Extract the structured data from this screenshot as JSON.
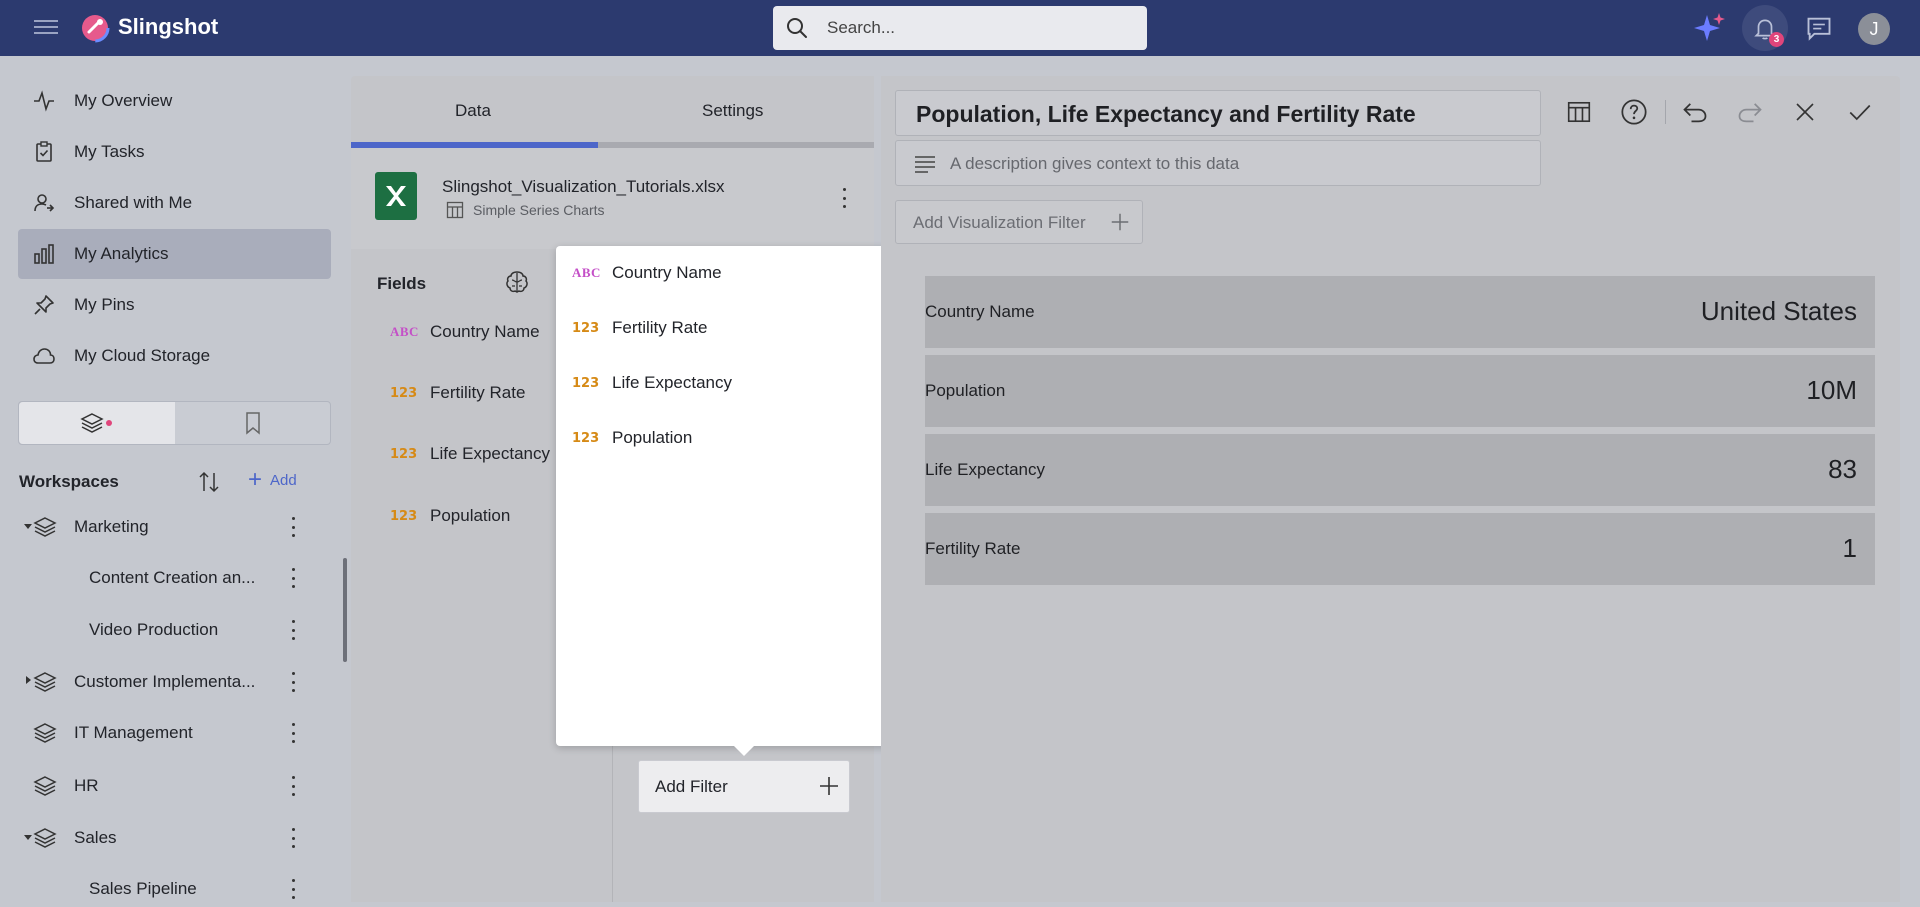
{
  "app": {
    "brand": "Slingshot"
  },
  "search": {
    "placeholder": "Search..."
  },
  "notifications": {
    "count": "3"
  },
  "user": {
    "initial": "J"
  },
  "sidebar": {
    "nav": [
      {
        "label": "My Overview",
        "icon": "activity-icon"
      },
      {
        "label": "My Tasks",
        "icon": "clipboard-check-icon"
      },
      {
        "label": "Shared with Me",
        "icon": "user-share-icon"
      },
      {
        "label": "My Analytics",
        "icon": "bar-chart-icon",
        "active": true
      },
      {
        "label": "My Pins",
        "icon": "pin-icon"
      },
      {
        "label": "My Cloud Storage",
        "icon": "cloud-icon"
      }
    ],
    "workspaces_title": "Workspaces",
    "add_label": "Add",
    "tree": [
      {
        "label": "Marketing",
        "level": 0,
        "expanded": true
      },
      {
        "label": "Content Creation an...",
        "level": 1
      },
      {
        "label": "Video Production",
        "level": 1
      },
      {
        "label": "Customer Implementa...",
        "level": 0,
        "expanded": false
      },
      {
        "label": "IT Management",
        "level": 0
      },
      {
        "label": "HR",
        "level": 0
      },
      {
        "label": "Sales",
        "level": 0,
        "expanded": true
      },
      {
        "label": "Sales Pipeline",
        "level": 1
      }
    ]
  },
  "datapanel": {
    "tabs": [
      "Data",
      "Settings"
    ],
    "active_tab": "Data",
    "source": {
      "file": "Slingshot_Visualization_Tutorials.xlsx",
      "sheet": "Simple Series Charts"
    },
    "fields_title": "Fields",
    "fields": [
      {
        "type": "ABC",
        "name": "Country Name"
      },
      {
        "type": "123",
        "name": "Fertility Rate"
      },
      {
        "type": "123",
        "name": "Life Expectancy"
      },
      {
        "type": "123",
        "name": "Population"
      }
    ],
    "add_filter_label": "Add Filter"
  },
  "popup": {
    "items": [
      {
        "type": "ABC",
        "name": "Country Name"
      },
      {
        "type": "123",
        "name": "Fertility Rate"
      },
      {
        "type": "123",
        "name": "Life Expectancy"
      },
      {
        "type": "123",
        "name": "Population"
      }
    ]
  },
  "editor": {
    "title": "Population, Life Expectancy and Fertility Rate",
    "description_placeholder": "A description gives context to this data",
    "add_viz_filter_label": "Add Visualization Filter",
    "kpis": [
      {
        "label": "Country Name",
        "value": "United States"
      },
      {
        "label": "Population",
        "value": "10M"
      },
      {
        "label": "Life Expectancy",
        "value": "83"
      },
      {
        "label": "Fertility Rate",
        "value": "1"
      }
    ]
  },
  "colors": {
    "topbar": "#2c3a6f",
    "accent": "#4d66c9",
    "abc_type": "#c44fc7",
    "num_type": "#d68a16",
    "excel_green": "#1d6f42"
  }
}
